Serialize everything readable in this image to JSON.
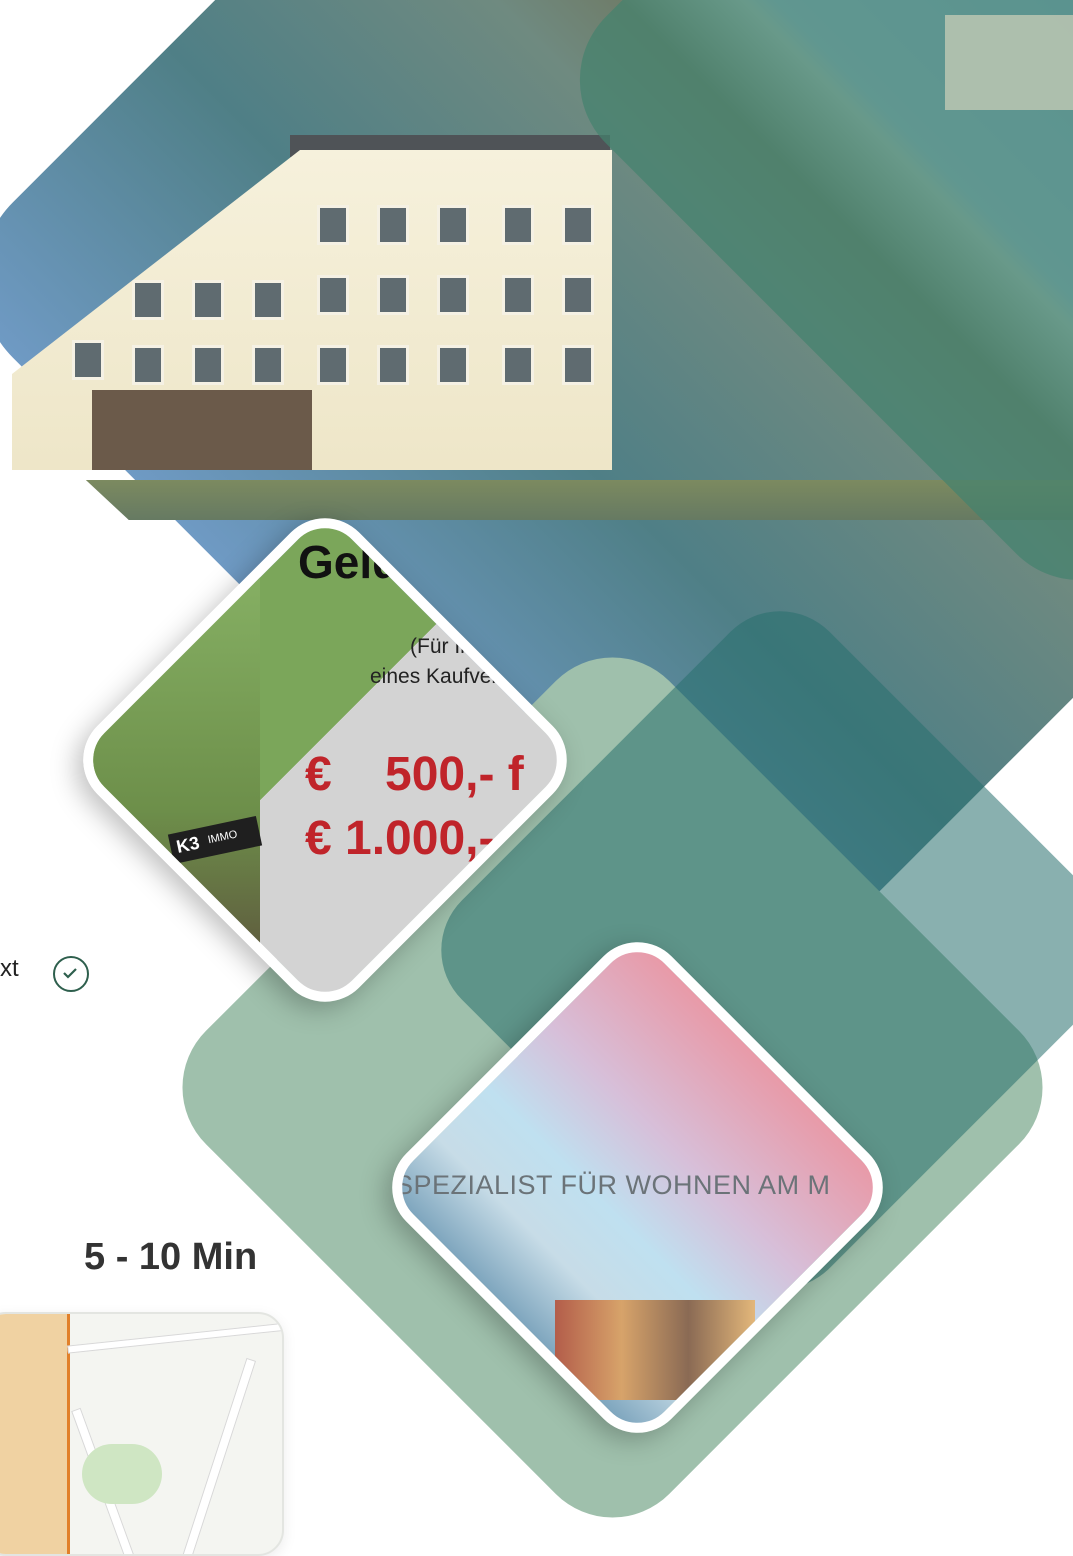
{
  "ad": {
    "title": "Geld v",
    "sub_line1": "(Für Ih",
    "sub_line2": "eines Kaufvert",
    "price_line1": "€    500,- f",
    "price_line2": "€ 1.000,-",
    "tag_logo": "K3",
    "tag_text": "IMMO"
  },
  "sea_banner": {
    "text": "SPEZIALIST FÜR WOHNEN AM M"
  },
  "status": {
    "label": "xt",
    "icon": "check-circle-icon",
    "color": "#2e5f4d"
  },
  "commute": {
    "time": "5 - 10 Min"
  },
  "colors": {
    "green_overlay": "#44826e",
    "pale_green": "#9fc0ac",
    "teal": "#28706e",
    "price_red": "#c0242a"
  }
}
